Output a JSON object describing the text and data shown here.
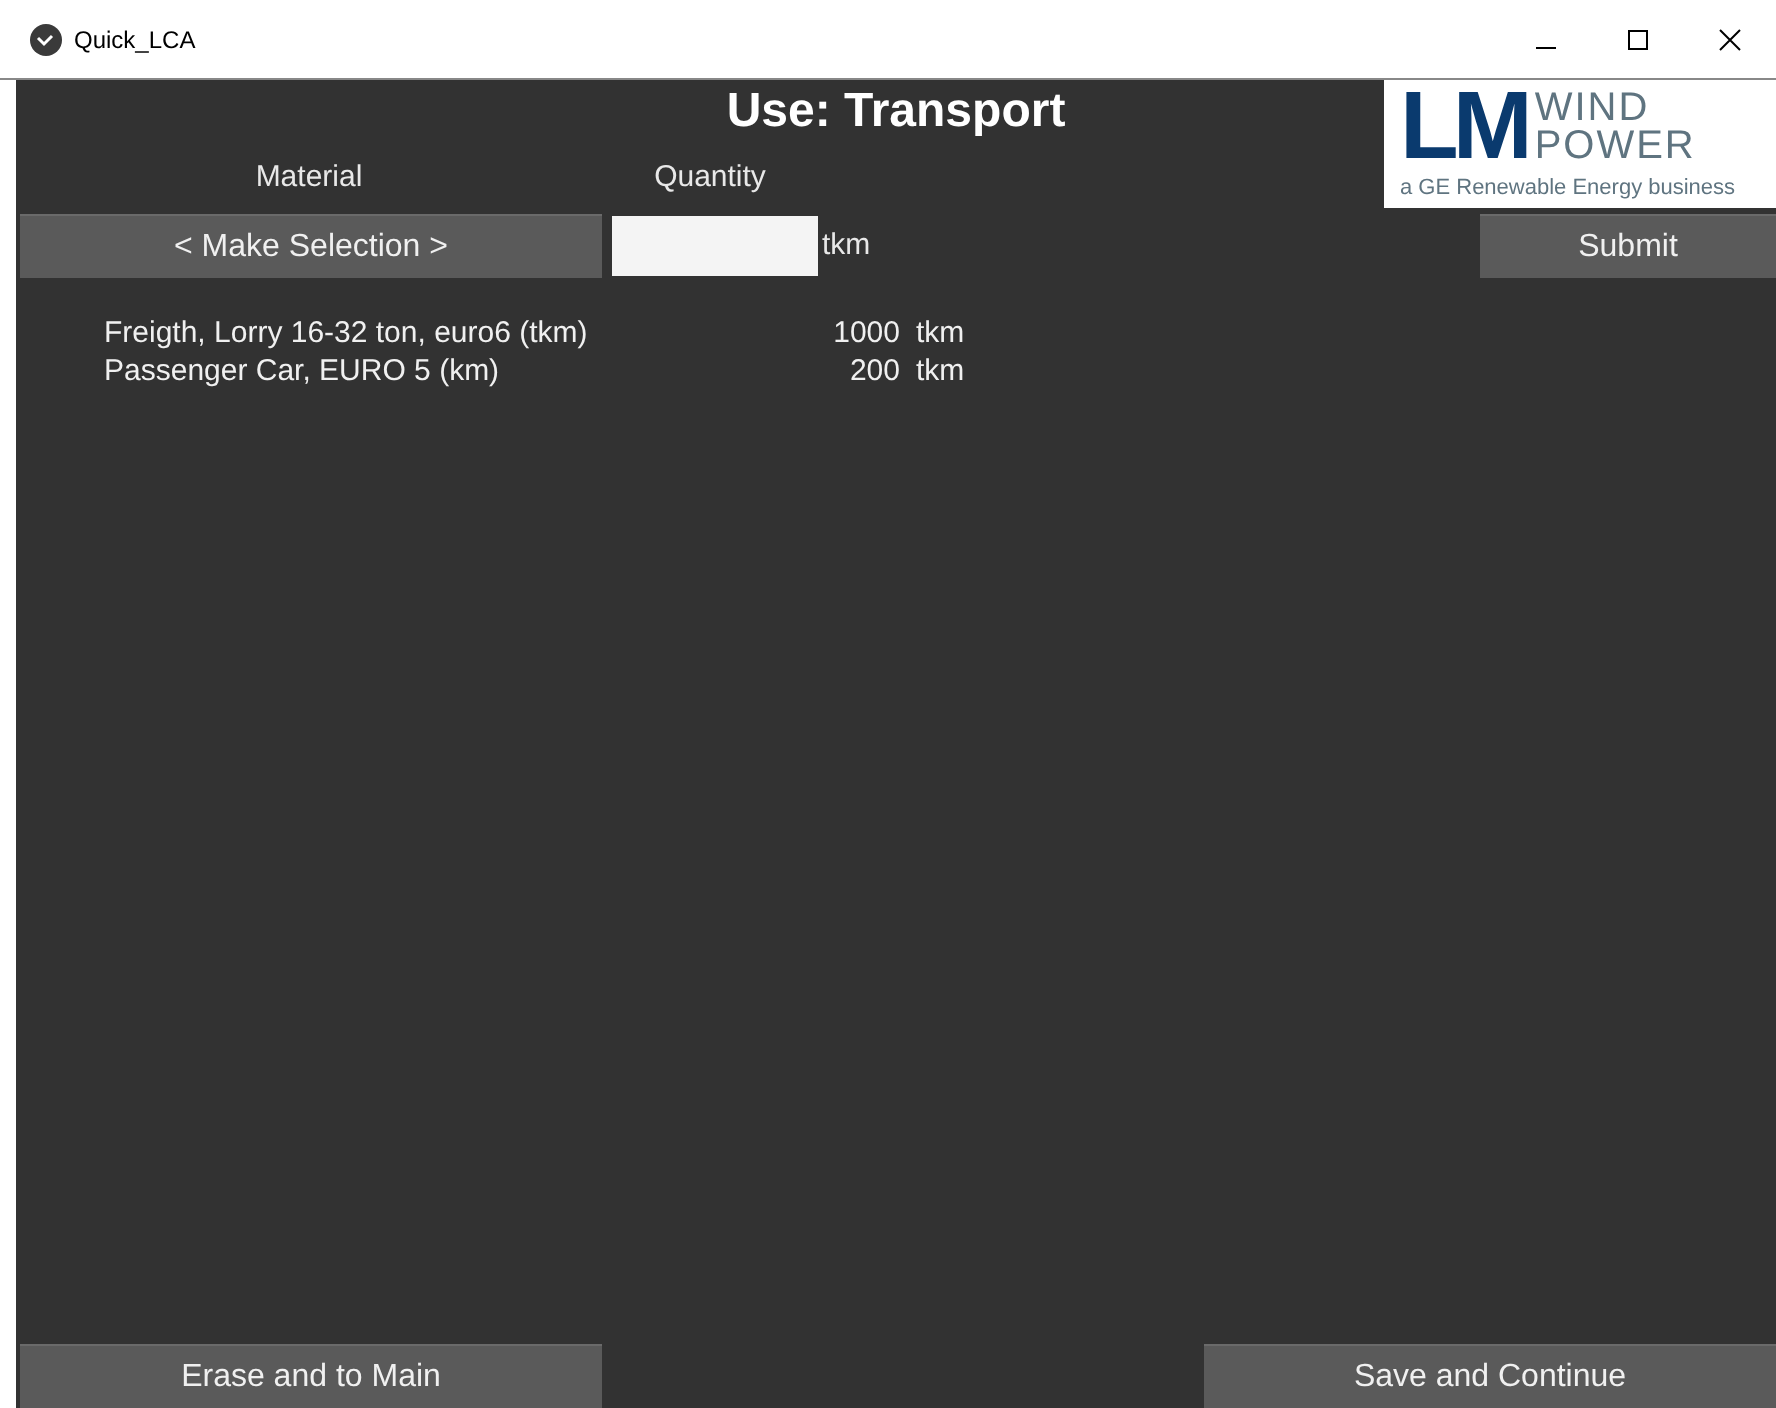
{
  "window": {
    "title": "Quick_LCA"
  },
  "heading": "Use: Transport",
  "logo": {
    "mark": "LM",
    "line_1": "WIND",
    "line_2": "POWER",
    "tagline": "a GE Renewable Energy business"
  },
  "columns": {
    "material": "Material",
    "quantity": "Quantity"
  },
  "selection_button": "< Make Selection >",
  "quantity_field": {
    "unit": "tkm"
  },
  "submit_button": "Submit",
  "items": [
    {
      "name": "Freigth, Lorry 16-32 ton, euro6 (tkm)",
      "quantity": "1000",
      "unit": "tkm"
    },
    {
      "name": "Passenger Car, EURO 5 (km)",
      "quantity": "200",
      "unit": "tkm"
    }
  ],
  "footer_buttons": [
    "Erase and to Main",
    "Save and Continue"
  ]
}
